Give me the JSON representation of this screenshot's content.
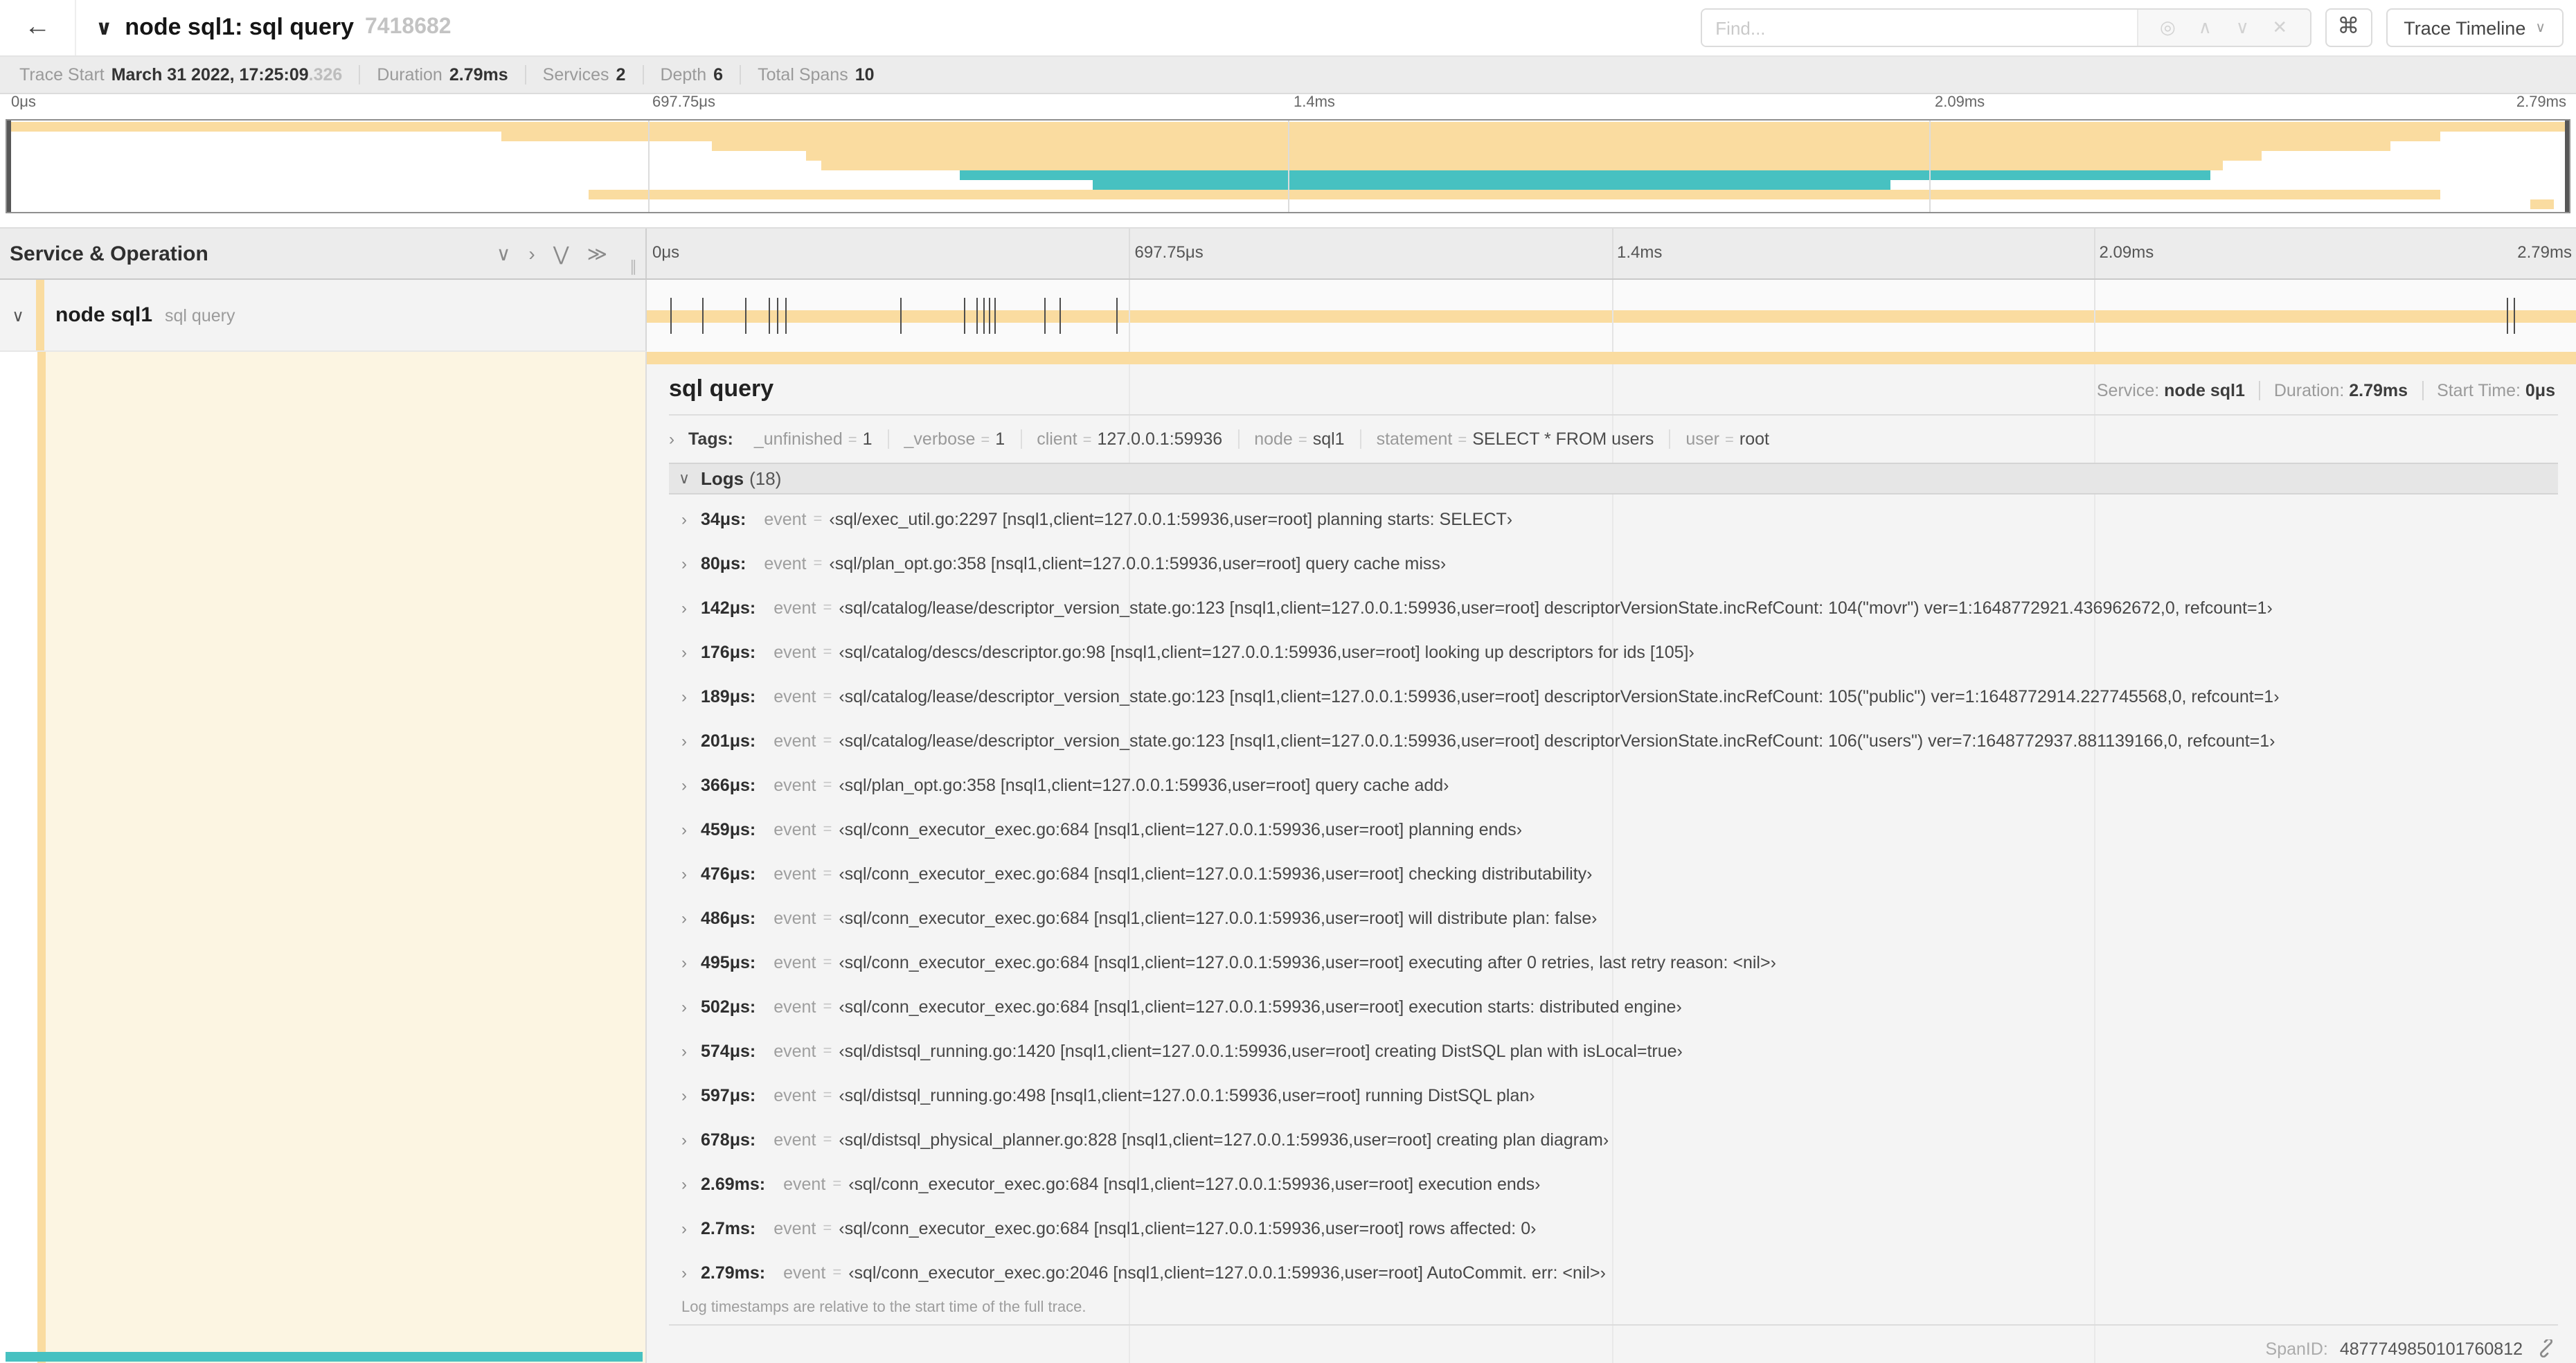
{
  "colors": {
    "span_tan": "#FADCA0",
    "span_teal": "#47C1C1",
    "cream": "#FCF5E2"
  },
  "header": {
    "back": "←",
    "collapse_chevron": "∨",
    "title": "node sql1: sql query",
    "trace_id": "7418682",
    "find_placeholder": "Find...",
    "locate_icon": "◎",
    "prev_icon": "∧",
    "next_icon": "∨",
    "clear_icon": "✕",
    "shortcut_icon": "⌘",
    "view_dropdown": "Trace Timeline",
    "caret": "∨"
  },
  "meta": {
    "items": [
      {
        "label": "Trace Start",
        "value": "March 31 2022, 17:25:09",
        "value_suffix": ".326"
      },
      {
        "label": "Duration",
        "value": "2.79ms"
      },
      {
        "label": "Services",
        "value": "2"
      },
      {
        "label": "Depth",
        "value": "6"
      },
      {
        "label": "Total Spans",
        "value": "10"
      }
    ]
  },
  "timeline": {
    "ticks": [
      "0μs",
      "697.75μs",
      "1.4ms",
      "2.09ms",
      "2.79ms"
    ],
    "duration_us": 2790
  },
  "minimap": {
    "bars": [
      {
        "start": 0,
        "end": 100,
        "color": "span_tan"
      },
      {
        "start": 19.3,
        "end": 95,
        "color": "span_tan"
      },
      {
        "start": 27.5,
        "end": 93,
        "color": "span_tan"
      },
      {
        "start": 31.2,
        "end": 88,
        "color": "span_tan"
      },
      {
        "start": 31.8,
        "end": 86.5,
        "color": "span_tan"
      },
      {
        "start": 37.2,
        "end": 86,
        "color": "span_teal"
      },
      {
        "start": 42.4,
        "end": 73.5,
        "color": "span_teal"
      },
      {
        "start": 22.7,
        "end": 95,
        "color": "span_tan"
      },
      {
        "start": 98.5,
        "end": 99.4,
        "color": "span_tan"
      }
    ]
  },
  "span_tree": {
    "header": "Service & Operation",
    "icons": [
      {
        "name": "collapse-one",
        "glyph": "∨"
      },
      {
        "name": "expand-one",
        "glyph": "›"
      },
      {
        "name": "collapse-all",
        "glyph": "⋁"
      },
      {
        "name": "expand-all",
        "glyph": "≫"
      }
    ],
    "grip": "∥",
    "row": {
      "chevron": "∨",
      "service": "node sql1",
      "operation": "sql query"
    }
  },
  "detail": {
    "title": "sql query",
    "meta": [
      {
        "label": "Service:",
        "value": "node sql1"
      },
      {
        "label": "Duration:",
        "value": "2.79ms"
      },
      {
        "label": "Start Time:",
        "value": "0μs"
      }
    ],
    "tags_chevron": "›",
    "tags_label": "Tags:",
    "eq": "=",
    "tags": [
      {
        "key": "_unfinished",
        "value": "1"
      },
      {
        "key": "_verbose",
        "value": "1"
      },
      {
        "key": "client",
        "value": "127.0.0.1:59936"
      },
      {
        "key": "node",
        "value": "sql1"
      },
      {
        "key": "statement",
        "value": "SELECT * FROM users"
      },
      {
        "key": "user",
        "value": "root"
      }
    ],
    "logs_chevron": "∨",
    "logs_label": "Logs",
    "logs_count": "(18)",
    "row_chevron": "›",
    "logs": [
      {
        "time": "34μs:",
        "us": 34,
        "key": "event",
        "value": "‹sql/exec_util.go:2297 [nsql1,client=127.0.0.1:59936,user=root] planning starts: SELECT›"
      },
      {
        "time": "80μs:",
        "us": 80,
        "key": "event",
        "value": "‹sql/plan_opt.go:358 [nsql1,client=127.0.0.1:59936,user=root] query cache miss›"
      },
      {
        "time": "142μs:",
        "us": 142,
        "key": "event",
        "value": "‹sql/catalog/lease/descriptor_version_state.go:123 [nsql1,client=127.0.0.1:59936,user=root] descriptorVersionState.incRefCount: 104(\"movr\") ver=1:1648772921.436962672,0, refcount=1›"
      },
      {
        "time": "176μs:",
        "us": 176,
        "key": "event",
        "value": "‹sql/catalog/descs/descriptor.go:98 [nsql1,client=127.0.0.1:59936,user=root] looking up descriptors for ids [105]›"
      },
      {
        "time": "189μs:",
        "us": 189,
        "key": "event",
        "value": "‹sql/catalog/lease/descriptor_version_state.go:123 [nsql1,client=127.0.0.1:59936,user=root] descriptorVersionState.incRefCount: 105(\"public\") ver=1:1648772914.227745568,0, refcount=1›"
      },
      {
        "time": "201μs:",
        "us": 201,
        "key": "event",
        "value": "‹sql/catalog/lease/descriptor_version_state.go:123 [nsql1,client=127.0.0.1:59936,user=root] descriptorVersionState.incRefCount: 106(\"users\") ver=7:1648772937.881139166,0, refcount=1›"
      },
      {
        "time": "366μs:",
        "us": 366,
        "key": "event",
        "value": "‹sql/plan_opt.go:358 [nsql1,client=127.0.0.1:59936,user=root] query cache add›"
      },
      {
        "time": "459μs:",
        "us": 459,
        "key": "event",
        "value": "‹sql/conn_executor_exec.go:684 [nsql1,client=127.0.0.1:59936,user=root] planning ends›"
      },
      {
        "time": "476μs:",
        "us": 476,
        "key": "event",
        "value": "‹sql/conn_executor_exec.go:684 [nsql1,client=127.0.0.1:59936,user=root] checking distributability›"
      },
      {
        "time": "486μs:",
        "us": 486,
        "key": "event",
        "value": "‹sql/conn_executor_exec.go:684 [nsql1,client=127.0.0.1:59936,user=root] will distribute plan: false›"
      },
      {
        "time": "495μs:",
        "us": 495,
        "key": "event",
        "value": "‹sql/conn_executor_exec.go:684 [nsql1,client=127.0.0.1:59936,user=root] executing after 0 retries, last retry reason: <nil>›"
      },
      {
        "time": "502μs:",
        "us": 502,
        "key": "event",
        "value": "‹sql/conn_executor_exec.go:684 [nsql1,client=127.0.0.1:59936,user=root] execution starts: distributed engine›"
      },
      {
        "time": "574μs:",
        "us": 574,
        "key": "event",
        "value": "‹sql/distsql_running.go:1420 [nsql1,client=127.0.0.1:59936,user=root] creating DistSQL plan with isLocal=true›"
      },
      {
        "time": "597μs:",
        "us": 597,
        "key": "event",
        "value": "‹sql/distsql_running.go:498 [nsql1,client=127.0.0.1:59936,user=root] running DistSQL plan›"
      },
      {
        "time": "678μs:",
        "us": 678,
        "key": "event",
        "value": "‹sql/distsql_physical_planner.go:828 [nsql1,client=127.0.0.1:59936,user=root] creating plan diagram›"
      },
      {
        "time": "2.69ms:",
        "us": 2690,
        "key": "event",
        "value": "‹sql/conn_executor_exec.go:684 [nsql1,client=127.0.0.1:59936,user=root] execution ends›"
      },
      {
        "time": "2.7ms:",
        "us": 2700,
        "key": "event",
        "value": "‹sql/conn_executor_exec.go:684 [nsql1,client=127.0.0.1:59936,user=root] rows affected: 0›"
      },
      {
        "time": "2.79ms:",
        "us": 2790,
        "key": "event",
        "value": "‹sql/conn_executor_exec.go:2046 [nsql1,client=127.0.0.1:59936,user=root] AutoCommit. err: <nil>›"
      }
    ],
    "footer_note": "Log timestamps are relative to the start time of the full trace.",
    "span_id_label": "SpanID:",
    "span_id": "4877749850101760812"
  }
}
